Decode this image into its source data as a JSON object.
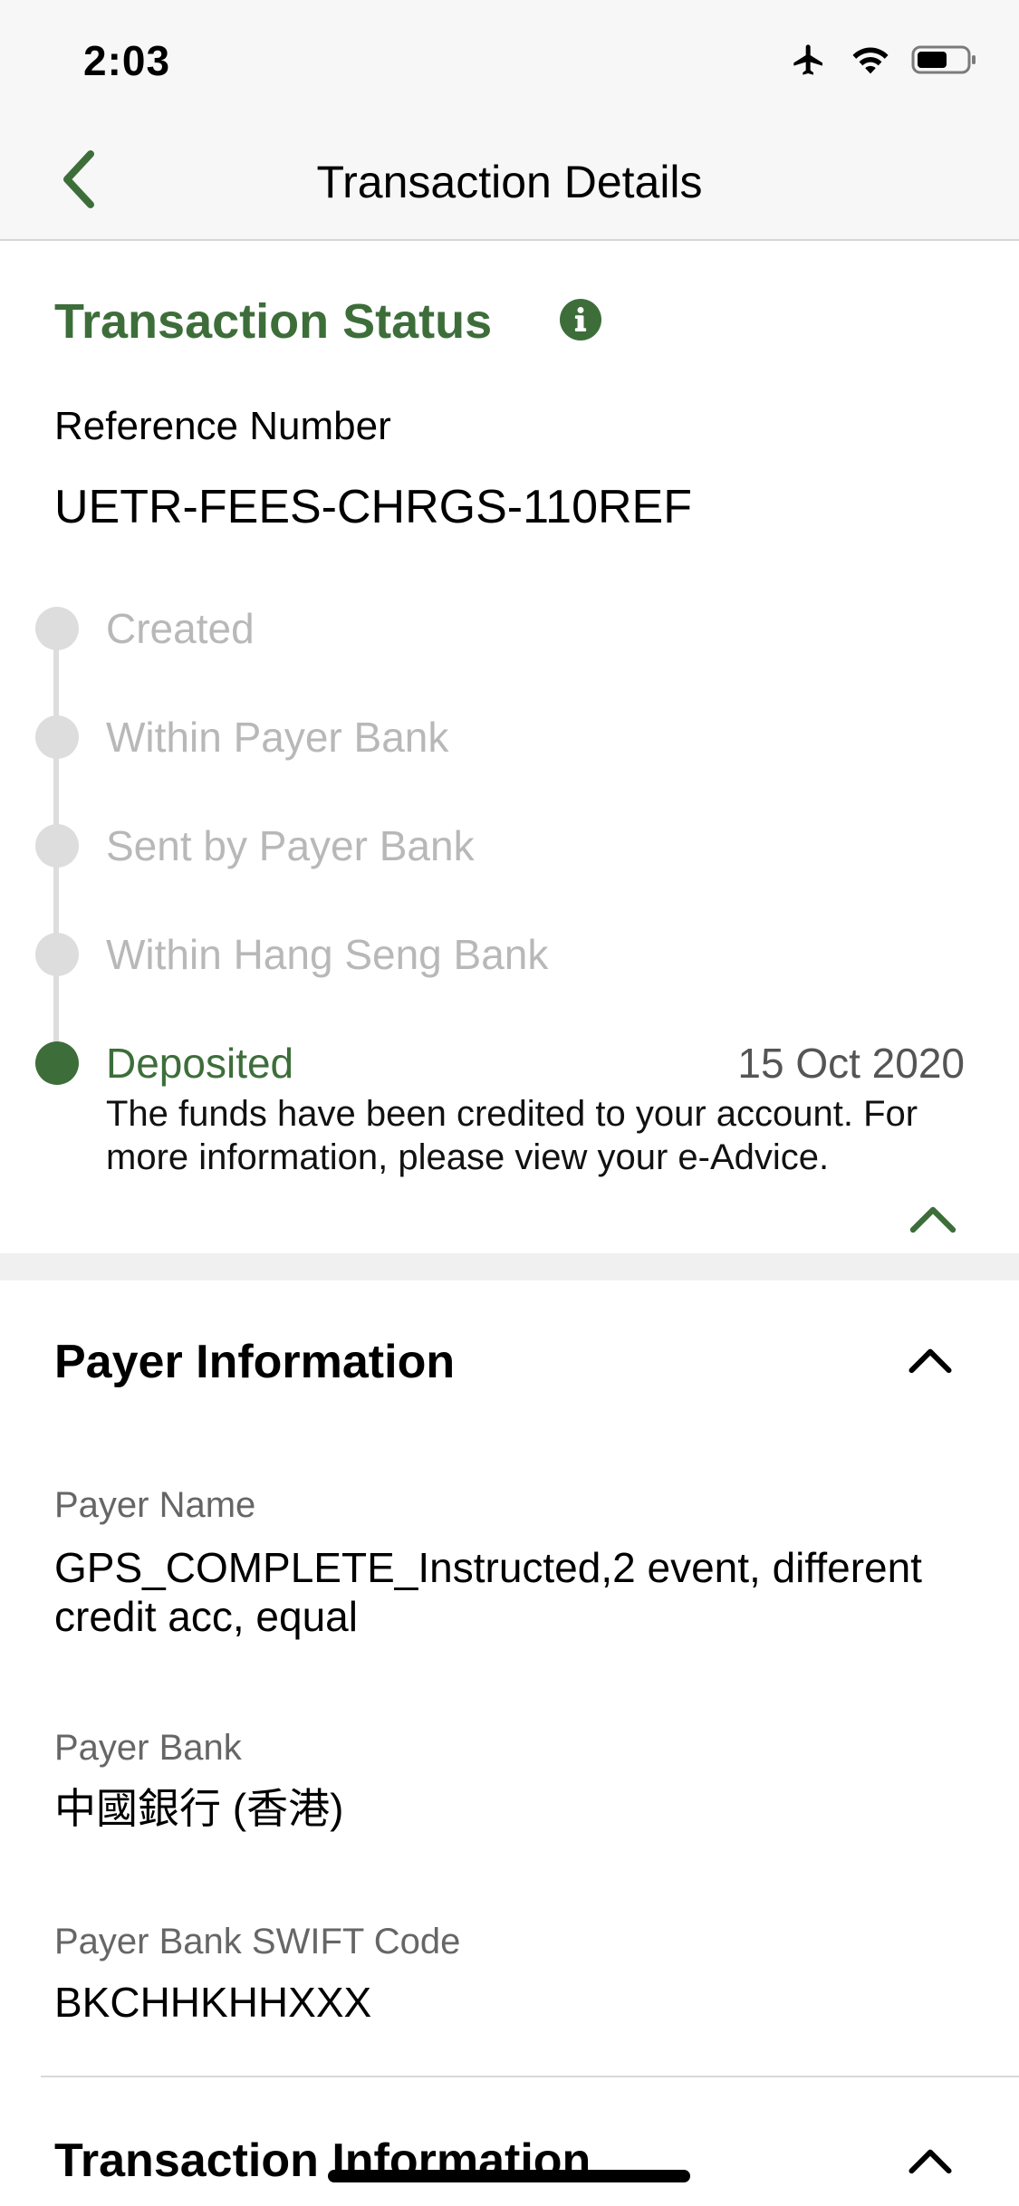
{
  "status_bar": {
    "time": "2:03"
  },
  "nav": {
    "title": "Transaction Details"
  },
  "status": {
    "heading": "Transaction Status",
    "reference_label": "Reference Number",
    "reference_value": "UETR-FEES-CHRGS-110REF",
    "steps": [
      {
        "label": "Created",
        "state": "inactive"
      },
      {
        "label": "Within Payer Bank",
        "state": "inactive"
      },
      {
        "label": "Sent by Payer Bank",
        "state": "inactive"
      },
      {
        "label": "Within Hang Seng Bank",
        "state": "inactive"
      },
      {
        "label": "Deposited",
        "state": "active",
        "date": "15 Oct 2020"
      }
    ],
    "description": "The funds have been credited to your account. For more information, please view your e-Advice."
  },
  "payer": {
    "heading": "Payer Information",
    "fields": [
      {
        "label": "Payer Name",
        "value": "GPS_COMPLETE_Instructed,2 event, different credit acc, equal"
      },
      {
        "label": "Payer Bank",
        "value": "中國銀行 (香港)"
      },
      {
        "label": "Payer Bank SWIFT Code",
        "value": "BKCHHKHHXXX"
      }
    ]
  },
  "transaction": {
    "heading": "Transaction Information"
  },
  "colors": {
    "accent_green": "#3d6e3a",
    "inactive_gray": "#b8b8b8",
    "background": "#ffffff",
    "bar_background": "#f7f7f7"
  },
  "icons": [
    "airplane-icon",
    "wifi-icon",
    "battery-icon",
    "back-chevron-icon",
    "info-icon",
    "chevron-up-icon"
  ]
}
